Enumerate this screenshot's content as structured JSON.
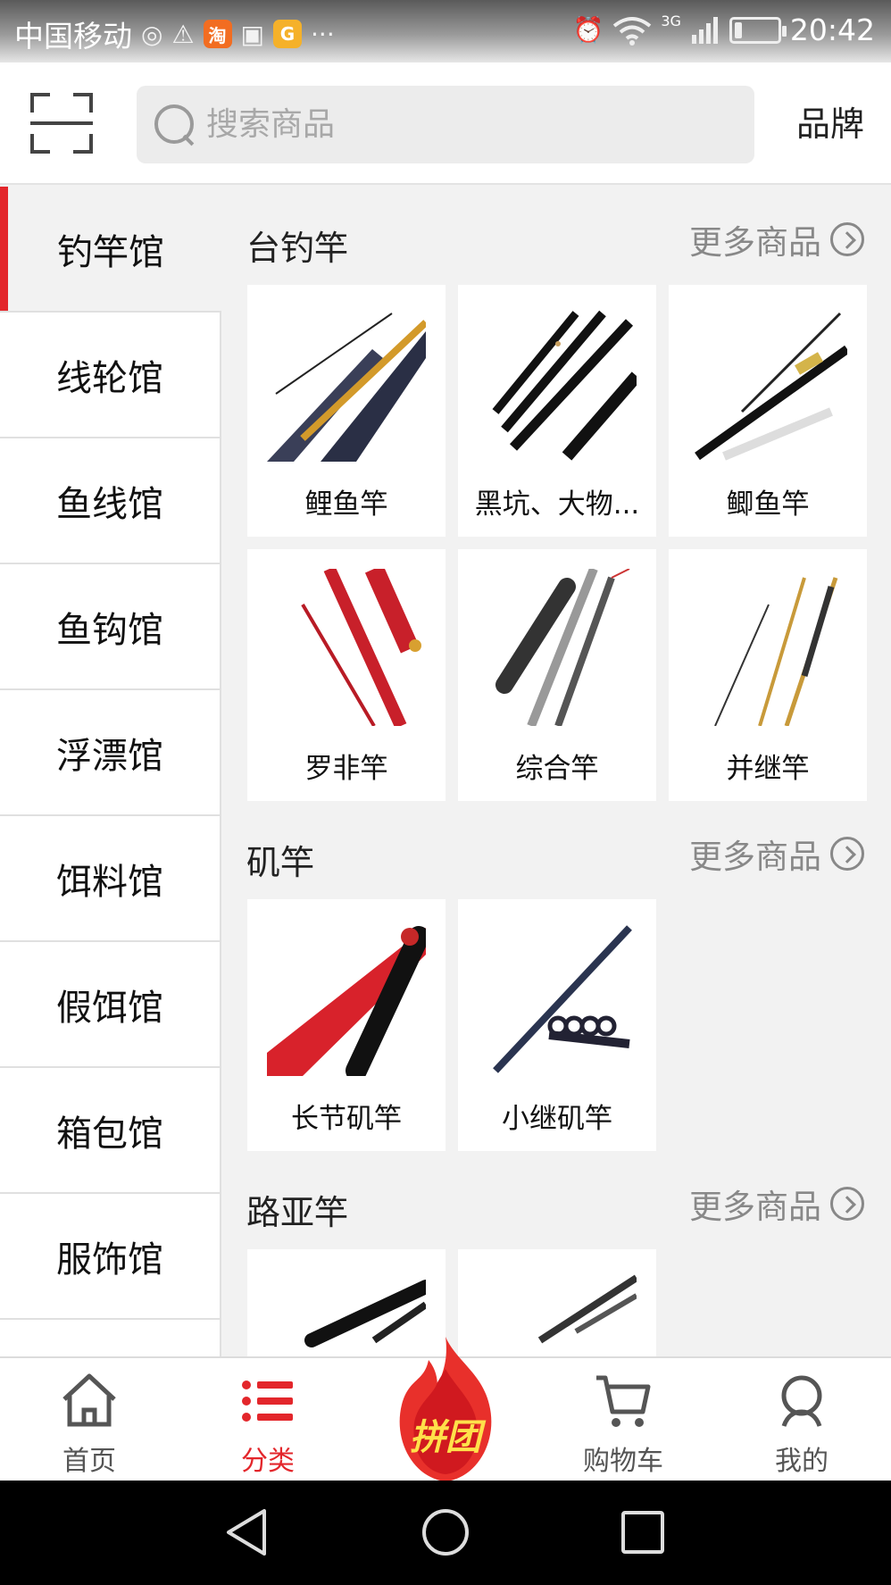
{
  "status_bar": {
    "carrier": "中国移动",
    "network": "3G",
    "time": "20:42",
    "battery_level": 0.15,
    "app_icon_taobao": "淘",
    "app_icon_g": "G",
    "more": "···"
  },
  "header": {
    "search_placeholder": "搜索商品",
    "brand_label": "品牌"
  },
  "sidebar": {
    "items": [
      {
        "label": "钓竿馆"
      },
      {
        "label": "线轮馆"
      },
      {
        "label": "鱼线馆"
      },
      {
        "label": "鱼钩馆"
      },
      {
        "label": "浮漂馆"
      },
      {
        "label": "饵料馆"
      },
      {
        "label": "假饵馆"
      },
      {
        "label": "箱包馆"
      },
      {
        "label": "服饰馆"
      }
    ],
    "active_index": 0
  },
  "sections": [
    {
      "title": "台钓竿",
      "more_label": "更多商品",
      "items": [
        {
          "label": "鲤鱼竿"
        },
        {
          "label": "黑坑、大物..."
        },
        {
          "label": "鲫鱼竿"
        },
        {
          "label": "罗非竿"
        },
        {
          "label": "综合竿"
        },
        {
          "label": "并继竿"
        }
      ]
    },
    {
      "title": "矶竿",
      "more_label": "更多商品",
      "items": [
        {
          "label": "长节矶竿"
        },
        {
          "label": "小继矶竿"
        }
      ]
    },
    {
      "title": "路亚竿",
      "more_label": "更多商品",
      "items": [
        {
          "label": ""
        },
        {
          "label": ""
        }
      ]
    }
  ],
  "bottom_nav": {
    "items": [
      {
        "label": "首页",
        "icon": "home-icon"
      },
      {
        "label": "分类",
        "icon": "list-icon"
      },
      {
        "label": "购物车",
        "icon": "cart-icon"
      },
      {
        "label": "我的",
        "icon": "user-icon"
      }
    ],
    "promo_label": "拼团",
    "active_color": "#e3262b"
  }
}
